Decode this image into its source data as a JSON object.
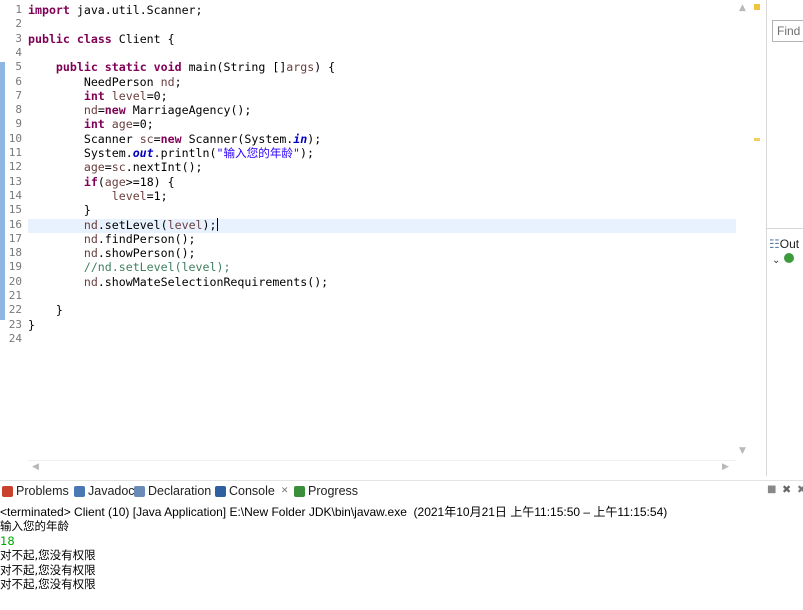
{
  "editor": {
    "line_numbers": [
      "1",
      "2",
      "3",
      "4",
      "5",
      "6",
      "7",
      "8",
      "9",
      "10",
      "11",
      "12",
      "13",
      "14",
      "15",
      "16",
      "17",
      "18",
      "19",
      "20",
      "21",
      "22",
      "23",
      "24"
    ],
    "lines": [
      [
        {
          "t": "import",
          "c": "kw"
        },
        {
          "t": " java.util.Scanner;"
        }
      ],
      [],
      [
        {
          "t": "public",
          "c": "kw"
        },
        {
          "t": " "
        },
        {
          "t": "class",
          "c": "kw"
        },
        {
          "t": " Client {"
        }
      ],
      [],
      [
        {
          "t": "    "
        },
        {
          "t": "public",
          "c": "kw"
        },
        {
          "t": " "
        },
        {
          "t": "static",
          "c": "kw"
        },
        {
          "t": " "
        },
        {
          "t": "void",
          "c": "kw"
        },
        {
          "t": " main(String []"
        },
        {
          "t": "args",
          "c": "var"
        },
        {
          "t": ") {"
        }
      ],
      [
        {
          "t": "        NeedPerson "
        },
        {
          "t": "nd",
          "c": "var"
        },
        {
          "t": ";"
        }
      ],
      [
        {
          "t": "        "
        },
        {
          "t": "int",
          "c": "kw"
        },
        {
          "t": " "
        },
        {
          "t": "level",
          "c": "var"
        },
        {
          "t": "=0;"
        }
      ],
      [
        {
          "t": "        "
        },
        {
          "t": "nd",
          "c": "var"
        },
        {
          "t": "="
        },
        {
          "t": "new",
          "c": "kw"
        },
        {
          "t": " MarriageAgency();"
        }
      ],
      [
        {
          "t": "        "
        },
        {
          "t": "int",
          "c": "kw"
        },
        {
          "t": " "
        },
        {
          "t": "age",
          "c": "var"
        },
        {
          "t": "=0;"
        }
      ],
      [
        {
          "t": "        Scanner "
        },
        {
          "t": "sc",
          "c": "var"
        },
        {
          "t": "="
        },
        {
          "t": "new",
          "c": "kw"
        },
        {
          "t": " Scanner(System."
        },
        {
          "t": "in",
          "c": "fld"
        },
        {
          "t": ");"
        }
      ],
      [
        {
          "t": "        System."
        },
        {
          "t": "out",
          "c": "fld"
        },
        {
          "t": ".println("
        },
        {
          "t": "\"输入您的年龄\"",
          "c": "str"
        },
        {
          "t": ");"
        }
      ],
      [
        {
          "t": "        "
        },
        {
          "t": "age",
          "c": "var"
        },
        {
          "t": "="
        },
        {
          "t": "sc",
          "c": "var"
        },
        {
          "t": ".nextInt();"
        }
      ],
      [
        {
          "t": "        "
        },
        {
          "t": "if",
          "c": "kw"
        },
        {
          "t": "("
        },
        {
          "t": "age",
          "c": "var"
        },
        {
          "t": ">=18) {"
        }
      ],
      [
        {
          "t": "            "
        },
        {
          "t": "level",
          "c": "var"
        },
        {
          "t": "=1;"
        }
      ],
      [
        {
          "t": "        }"
        }
      ],
      [
        {
          "t": "        "
        },
        {
          "t": "nd",
          "c": "var"
        },
        {
          "t": ".setLevel("
        },
        {
          "t": "level",
          "c": "var"
        },
        {
          "t": ");"
        }
      ],
      [
        {
          "t": "        "
        },
        {
          "t": "nd",
          "c": "var"
        },
        {
          "t": ".findPerson();"
        }
      ],
      [
        {
          "t": "        "
        },
        {
          "t": "nd",
          "c": "var"
        },
        {
          "t": ".showPerson();"
        }
      ],
      [
        {
          "t": "        "
        },
        {
          "t": "//nd.setLevel(level);",
          "c": "cmt"
        }
      ],
      [
        {
          "t": "        "
        },
        {
          "t": "nd",
          "c": "var"
        },
        {
          "t": ".showMateSelectionRequirements();"
        }
      ],
      [],
      [
        {
          "t": "    }"
        }
      ],
      [
        {
          "t": "}"
        }
      ],
      []
    ]
  },
  "find": {
    "placeholder": "Find"
  },
  "outline": {
    "label": "Out"
  },
  "tabs": [
    {
      "label": "Problems",
      "icon": "problems-icon"
    },
    {
      "label": "Javadoc",
      "icon": "javadoc-icon"
    },
    {
      "label": "Declaration",
      "icon": "declaration-icon"
    },
    {
      "label": "Console",
      "icon": "console-icon",
      "active": true
    },
    {
      "label": "Progress",
      "icon": "progress-icon"
    }
  ],
  "console": {
    "header": "<terminated> Client (10) [Java Application] E:\\New Folder JDK\\bin\\javaw.exe  (2021年10月21日 上午11:15:50 – 上午11:15:54)",
    "output": [
      {
        "text": "输入您的年龄",
        "color": "black"
      },
      {
        "text": "18",
        "color": "green"
      },
      {
        "text": "对不起,您没有权限",
        "color": "black"
      },
      {
        "text": "对不起,您没有权限",
        "color": "black"
      },
      {
        "text": "对不起,您没有权限",
        "color": "black"
      }
    ]
  },
  "colors": {
    "keyword": "#7f0055",
    "string": "#2a00ff",
    "comment": "#3f7f5f",
    "input": "#00a800",
    "current_line": "#e8f2fe"
  }
}
